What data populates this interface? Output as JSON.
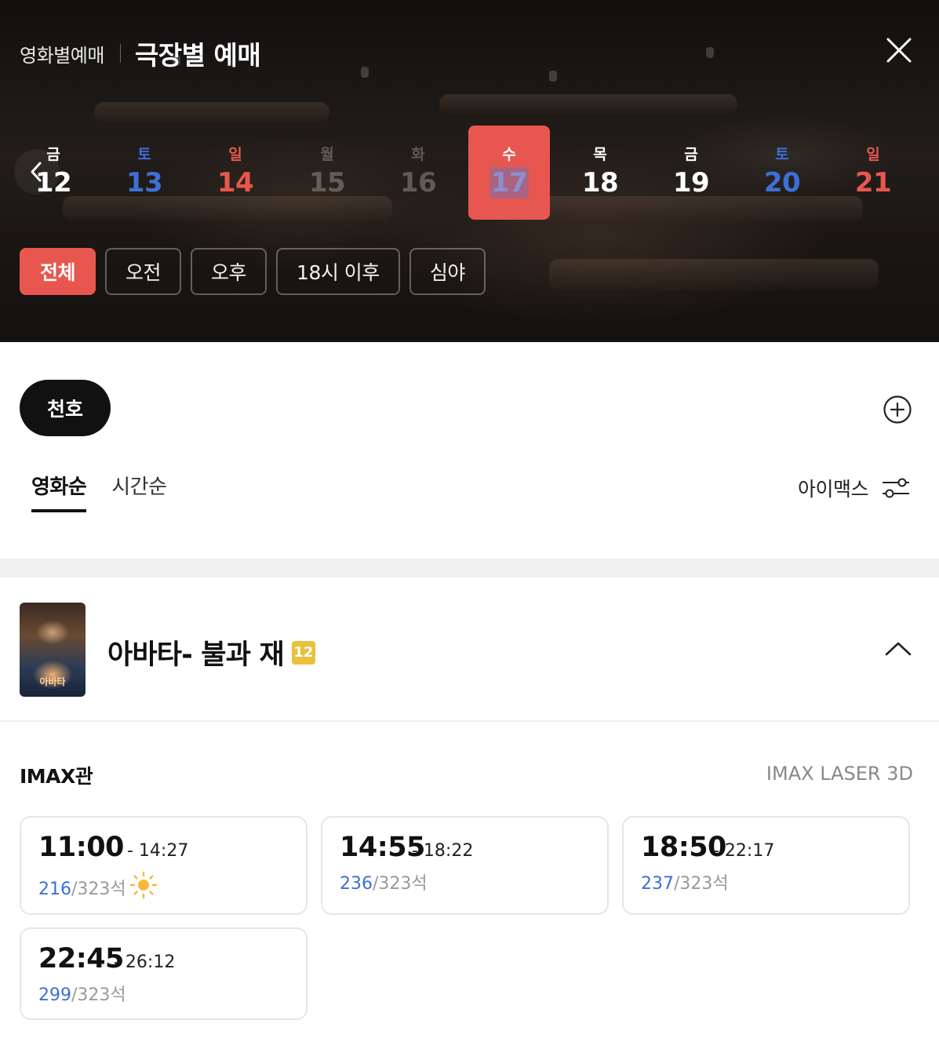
{
  "header": {
    "mode_inactive": "영화별예매",
    "mode_active": "극장별 예매"
  },
  "dates": [
    {
      "dow": "금",
      "day": "12",
      "style": "white"
    },
    {
      "dow": "토",
      "day": "13",
      "style": "sat"
    },
    {
      "dow": "일",
      "day": "14",
      "style": "sun"
    },
    {
      "dow": "월",
      "day": "15",
      "style": "dim"
    },
    {
      "dow": "화",
      "day": "16",
      "style": "dim"
    },
    {
      "dow": "수",
      "day": "17",
      "style": "selected"
    },
    {
      "dow": "목",
      "day": "18",
      "style": "white"
    },
    {
      "dow": "금",
      "day": "19",
      "style": "white"
    },
    {
      "dow": "토",
      "day": "20",
      "style": "sat"
    },
    {
      "dow": "일",
      "day": "21",
      "style": "sun"
    }
  ],
  "time_filters": [
    "전체",
    "오전",
    "오후",
    "18시 이후",
    "심야"
  ],
  "theater": {
    "name": "천호"
  },
  "sort": {
    "tabs": [
      "영화순",
      "시간순"
    ]
  },
  "format_filter": {
    "label": "아이맥스"
  },
  "movie": {
    "title": "아바타- 불과 재",
    "rating": "12",
    "poster_text": "아바타"
  },
  "screen": {
    "name": "IMAX관",
    "format": "IMAX LASER 3D"
  },
  "showtimes": [
    {
      "start": "11:00",
      "end": "- 14:27",
      "remaining": "216",
      "total": "/323석",
      "morning": true
    },
    {
      "start": "14:55",
      "end": "- 18:22",
      "remaining": "236",
      "total": "/323석",
      "morning": false
    },
    {
      "start": "18:50",
      "end": "- 22:17",
      "remaining": "237",
      "total": "/323석",
      "morning": false
    },
    {
      "start": "22:45",
      "end": "- 26:12",
      "remaining": "299",
      "total": "/323석",
      "morning": false
    }
  ],
  "colors": {
    "accent": "#e8574f",
    "saturday": "#3d6fd6",
    "sunday": "#e8574f",
    "remaining_seats": "#3d6fd6",
    "rating_badge": "#e9c13a"
  },
  "icons": {
    "close": "close-icon",
    "prev": "chevron-left-icon",
    "add": "plus-circle-icon",
    "filter": "sliders-icon",
    "collapse": "chevron-up-icon",
    "morning": "sun-icon"
  }
}
